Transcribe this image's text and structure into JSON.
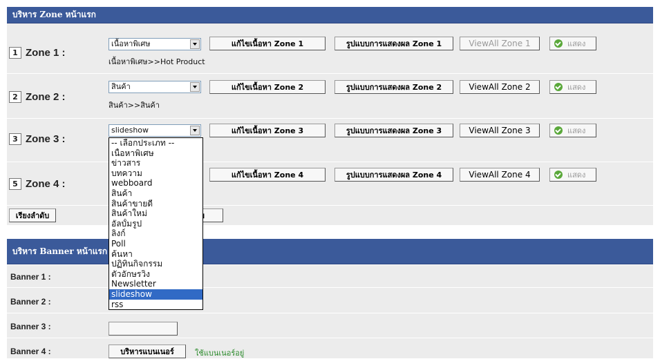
{
  "zone_panel": {
    "title": "บริหาร Zone หน้าแรก"
  },
  "zones": [
    {
      "num": "1",
      "label": "Zone 1 :",
      "selected": "เนื้อหาพิเศษ",
      "edit": "แก้ไขเนื้อหา Zone 1",
      "format": "รูปแบบการแสดงผล Zone 1",
      "viewall": "ViewAll Zone 1",
      "path": "เนื้อหาพิเศษ>>Hot Product"
    },
    {
      "num": "2",
      "label": "Zone 2 :",
      "selected": "สินค้า",
      "edit": "แก้ไขเนื้อหา Zone 2",
      "format": "รูปแบบการแสดงผล Zone 2",
      "viewall": "ViewAll Zone 2",
      "path": "สินค้า>>สินค้า"
    },
    {
      "num": "3",
      "label": "Zone 3 :",
      "selected": "slideshow",
      "edit": "แก้ไขเนื้อหา Zone 3",
      "format": "รูปแบบการแสดงผล Zone 3",
      "viewall": "ViewAll Zone 3",
      "path": ""
    },
    {
      "num": "5",
      "label": "Zone 4 :",
      "selected": "",
      "edit": "แก้ไขเนื้อหา Zone 4",
      "format": "รูปแบบการแสดงผล Zone 4",
      "viewall": "ViewAll Zone 4",
      "path": ""
    }
  ],
  "show_label": "แสดง",
  "sort_button": "เรียงลำดับ",
  "partial_button": "บ",
  "dropdown_options": [
    "-- เลือกประเภท --",
    "เนื้อหาพิเศษ",
    "ข่าวสาร",
    "บทความ",
    "webboard",
    "สินค้า",
    "สินค้าขายดี",
    "สินค้าใหม่",
    "อัลบั้มรูป",
    "ลิงก์",
    "Poll",
    "ค้นหา",
    "ปฏิทินกิจกรรม",
    "ตัวอักษรวิ่ง",
    "Newsletter",
    "slideshow",
    "rss"
  ],
  "dropdown_selected_index": 15,
  "banner_panel": {
    "title": "บริหาร Banner หน้าแรก"
  },
  "banners": [
    {
      "label": "Banner 1 :"
    },
    {
      "label": "Banner 2 :"
    },
    {
      "label": "Banner 3 :"
    },
    {
      "label": "Banner 4 :"
    }
  ],
  "banner4_manage": "บริหารแบนเนอร์",
  "banner4_status": "ใช้แบนเนอร์อยู่",
  "colors": {
    "header": "#3b5a9a",
    "row": "#ececec",
    "selection": "#316ac5",
    "green": "#2a8a2a"
  }
}
